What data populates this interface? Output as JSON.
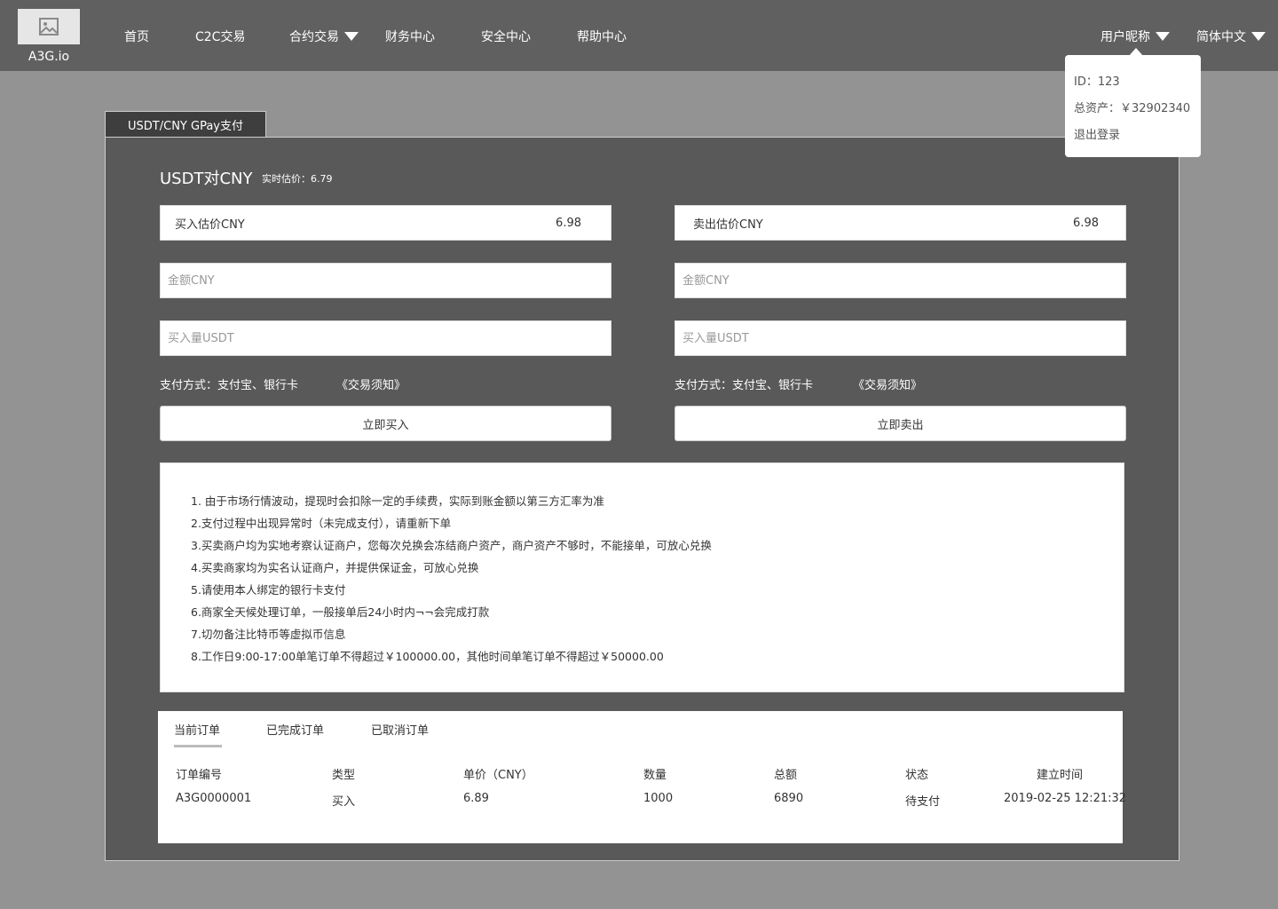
{
  "header": {
    "logo_text": "A3G.io",
    "nav": [
      "首页",
      "C2C交易",
      "合约交易",
      "财务中心",
      "安全中心",
      "帮助中心"
    ],
    "user_label": "用户昵称",
    "lang_label": "简体中文"
  },
  "user_menu": {
    "id_line": "ID：123",
    "assets_line": "总资产：￥32902340",
    "logout": "退出登录"
  },
  "panel": {
    "tab_label": "USDT/CNY GPay支付",
    "pair_title": "USDT对CNY",
    "realtime_price": "实时估价：6.79"
  },
  "buy": {
    "estimate_label": "买入估价CNY",
    "estimate_value": "6.98",
    "amount_placeholder": "金额CNY",
    "qty_placeholder": "买入量USDT",
    "payment": "支付方式：支付宝、银行卡",
    "notice": "《交易须知》",
    "button": "立即买入"
  },
  "sell": {
    "estimate_label": "卖出估价CNY",
    "estimate_value": "6.98",
    "amount_placeholder": "金额CNY",
    "qty_placeholder": "买入量USDT",
    "payment": "支付方式：支付宝、银行卡",
    "notice": "《交易须知》",
    "button": "立即卖出"
  },
  "notes": [
    "1. 由于市场行情波动，提现时会扣除一定的手续费，实际到账金额以第三方汇率为准",
    "2.支付过程中出现异常时（未完成支付），请重新下单",
    "3.买卖商户均为实地考察认证商户，您每次兑换会冻结商户资产，商户资产不够时，不能接单，可放心兑换",
    "4.买卖商家均为实名认证商户，并提供保证金，可放心兑换",
    "5.请使用本人绑定的银行卡支付",
    "6.商家全天候处理订单，一般接单后24小时内¬¬会完成打款",
    "7.切勿备注比特币等虚拟币信息",
    "8.工作日9:00-17:00单笔订单不得超过￥100000.00，其他时间单笔订单不得超过￥50000.00"
  ],
  "orders": {
    "tabs": [
      "当前订单",
      "已完成订单",
      "已取消订单"
    ],
    "active_tab": "当前订单",
    "columns": [
      "订单编号",
      "类型",
      "单价（CNY）",
      "数量",
      "总额",
      "状态",
      "建立时间"
    ],
    "rows": [
      [
        "A3G0000001",
        "买入",
        "6.89",
        "1000",
        "6890",
        "待支付",
        "2019-02-25 12:21:32"
      ]
    ]
  }
}
